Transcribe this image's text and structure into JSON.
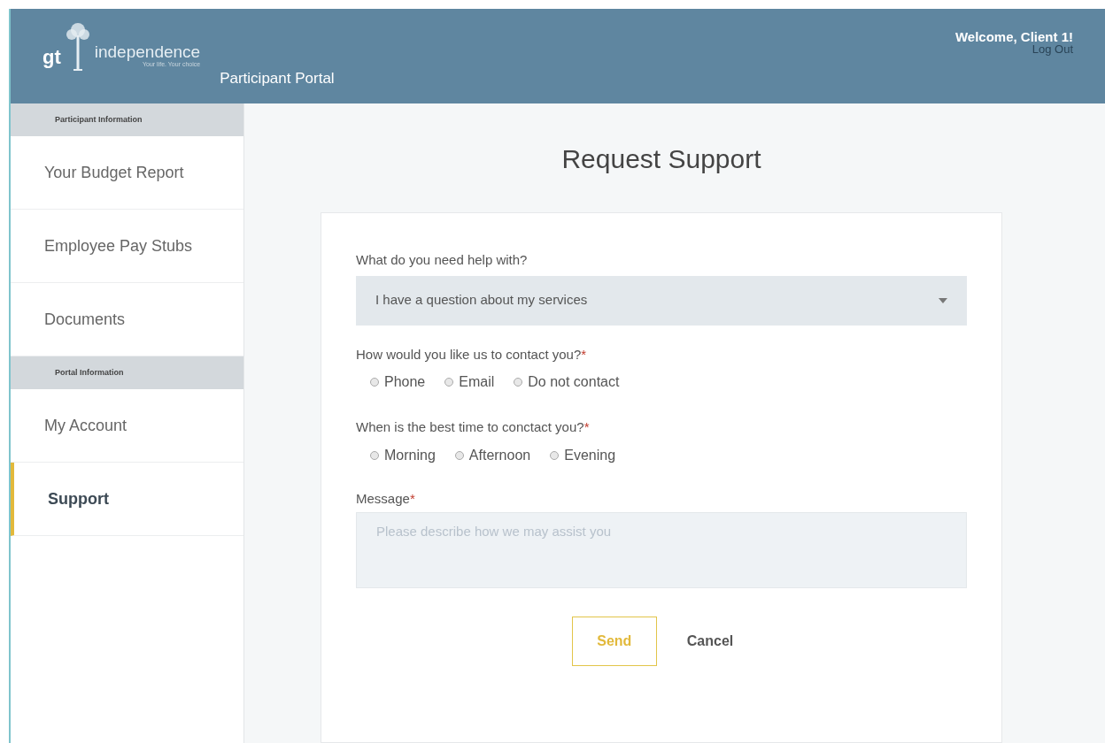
{
  "header": {
    "logo": {
      "mark": "gt",
      "name": "independence",
      "tagline": "Your life. Your choice"
    },
    "portal_title": "Participant Portal",
    "welcome": "Welcome, Client 1!",
    "logout": "Log Out"
  },
  "sidebar": {
    "sections": [
      {
        "title": "Participant Information",
        "items": [
          {
            "label": "Your Budget Report",
            "selected": false
          },
          {
            "label": "Employee Pay Stubs",
            "selected": false
          },
          {
            "label": "Documents",
            "selected": false
          }
        ]
      },
      {
        "title": "Portal Information",
        "items": [
          {
            "label": "My Account",
            "selected": false
          },
          {
            "label": "Support",
            "selected": true
          }
        ]
      }
    ]
  },
  "page_title": "Request Support",
  "form": {
    "help_label": "What do you need help with?",
    "help_value": "I have a question about my services",
    "contact_label": "How would you like us to contact you?",
    "contact_required": "*",
    "contact_options": [
      {
        "label": "Phone",
        "selected": false
      },
      {
        "label": "Email",
        "selected": false
      },
      {
        "label": "Do not contact",
        "selected": false
      }
    ],
    "time_label": "When is the best time to conctact you?",
    "time_required": "*",
    "time_options": [
      {
        "label": "Morning",
        "selected": false
      },
      {
        "label": "Afternoon",
        "selected": false
      },
      {
        "label": "Evening",
        "selected": false
      }
    ],
    "message_label": "Message",
    "message_required": "*",
    "message_placeholder": "Please describe how we may assist you",
    "send": "Send",
    "cancel": "Cancel"
  }
}
